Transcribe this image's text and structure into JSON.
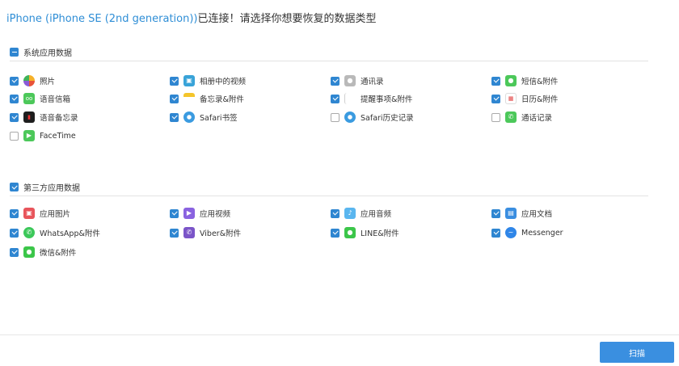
{
  "header": {
    "device": "iPhone (iPhone SE (2nd generation))",
    "message": "已连接！请选择你想要恢复的数据类型"
  },
  "sections": {
    "system": {
      "label": "系统应用数据",
      "items": [
        {
          "label": "照片",
          "checked": true,
          "icon": "photos-icon"
        },
        {
          "label": "相册中的视频",
          "checked": true,
          "icon": "album-video-icon"
        },
        {
          "label": "通讯录",
          "checked": true,
          "icon": "contacts-icon"
        },
        {
          "label": "短信&附件",
          "checked": true,
          "icon": "messages-icon"
        },
        {
          "label": "语音信箱",
          "checked": true,
          "icon": "voicemail-icon"
        },
        {
          "label": "备忘录&附件",
          "checked": true,
          "icon": "notes-icon"
        },
        {
          "label": "提醒事项&附件",
          "checked": true,
          "icon": "reminders-icon"
        },
        {
          "label": "日历&附件",
          "checked": true,
          "icon": "calendar-icon"
        },
        {
          "label": "语音备忘录",
          "checked": true,
          "icon": "voice-memos-icon"
        },
        {
          "label": "Safari书签",
          "checked": true,
          "icon": "safari-icon"
        },
        {
          "label": "Safari历史记录",
          "checked": false,
          "icon": "safari-icon"
        },
        {
          "label": "通话记录",
          "checked": false,
          "icon": "phone-icon"
        },
        {
          "label": "FaceTime",
          "checked": false,
          "icon": "facetime-icon"
        }
      ]
    },
    "third_party": {
      "label": "第三方应用数据",
      "items": [
        {
          "label": "应用图片",
          "checked": true,
          "icon": "app-photos-icon"
        },
        {
          "label": "应用视频",
          "checked": true,
          "icon": "app-video-icon"
        },
        {
          "label": "应用音频",
          "checked": true,
          "icon": "app-audio-icon"
        },
        {
          "label": "应用文档",
          "checked": true,
          "icon": "app-document-icon"
        },
        {
          "label": "WhatsApp&附件",
          "checked": true,
          "icon": "whatsapp-icon"
        },
        {
          "label": "Viber&附件",
          "checked": true,
          "icon": "viber-icon"
        },
        {
          "label": "LINE&附件",
          "checked": true,
          "icon": "line-icon"
        },
        {
          "label": "Messenger",
          "checked": true,
          "icon": "messenger-icon"
        },
        {
          "label": "微信&附件",
          "checked": true,
          "icon": "wechat-icon"
        }
      ]
    }
  },
  "footer": {
    "scan_label": "扫描"
  },
  "colors": {
    "accent": "#2f86d1",
    "device_text": "#2f8ed6",
    "button": "#3a8fe0"
  }
}
